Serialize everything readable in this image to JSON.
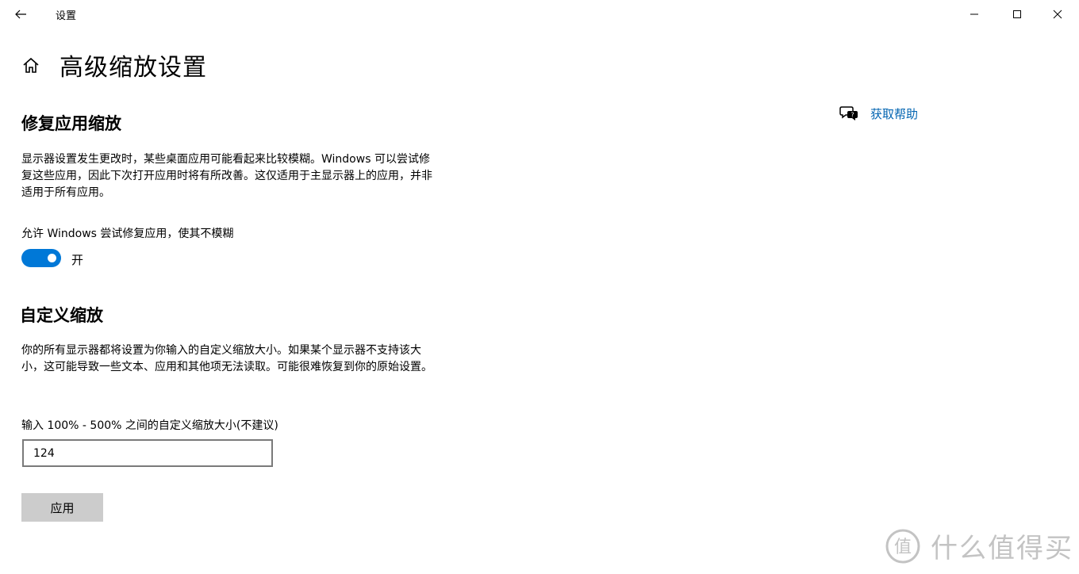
{
  "window": {
    "title": "设置"
  },
  "page": {
    "title": "高级缩放设置"
  },
  "help": {
    "link_label": "获取帮助"
  },
  "fix_scaling": {
    "heading": "修复应用缩放",
    "description": "显示器设置发生更改时，某些桌面应用可能看起来比较模糊。Windows 可以尝试修复这些应用，因此下次打开应用时将有所改善。这仅适用于主显示器上的应用，并非适用于所有应用。",
    "toggle_label": "允许 Windows 尝试修复应用，使其不模糊",
    "toggle_state_label": "开",
    "toggle_on": true
  },
  "custom_scaling": {
    "heading": "自定义缩放",
    "description": "你的所有显示器都将设置为你输入的自定义缩放大小。如果某个显示器不支持该大小，这可能导致一些文本、应用和其他项无法读取。可能很难恢复到你的原始设置。",
    "input_label": "输入 100% - 500% 之间的自定义缩放大小(不建议)",
    "input_value": "124",
    "apply_label": "应用"
  },
  "watermark": {
    "text": "什么值得买"
  },
  "colors": {
    "accent": "#0078d7",
    "link": "#0063b1",
    "button_bg": "#cccccc"
  },
  "icons": {
    "back": "arrow-left-icon",
    "home": "home-icon",
    "help": "chat-help-icon",
    "minimize": "minimize-icon",
    "maximize": "maximize-icon",
    "close": "close-icon"
  }
}
